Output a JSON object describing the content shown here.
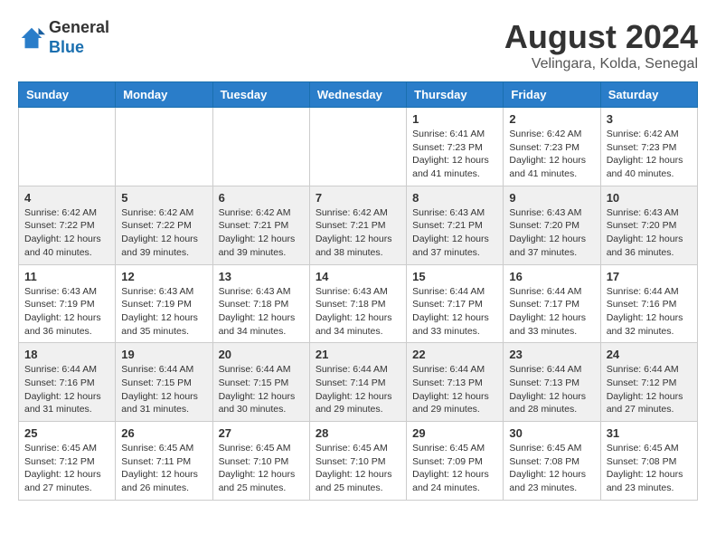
{
  "header": {
    "logo_line1": "General",
    "logo_line2": "Blue",
    "title": "August 2024",
    "subtitle": "Velingara, Kolda, Senegal"
  },
  "weekdays": [
    "Sunday",
    "Monday",
    "Tuesday",
    "Wednesday",
    "Thursday",
    "Friday",
    "Saturday"
  ],
  "weeks": [
    [
      {
        "day": "",
        "info": ""
      },
      {
        "day": "",
        "info": ""
      },
      {
        "day": "",
        "info": ""
      },
      {
        "day": "",
        "info": ""
      },
      {
        "day": "1",
        "info": "Sunrise: 6:41 AM\nSunset: 7:23 PM\nDaylight: 12 hours\nand 41 minutes."
      },
      {
        "day": "2",
        "info": "Sunrise: 6:42 AM\nSunset: 7:23 PM\nDaylight: 12 hours\nand 41 minutes."
      },
      {
        "day": "3",
        "info": "Sunrise: 6:42 AM\nSunset: 7:23 PM\nDaylight: 12 hours\nand 40 minutes."
      }
    ],
    [
      {
        "day": "4",
        "info": "Sunrise: 6:42 AM\nSunset: 7:22 PM\nDaylight: 12 hours\nand 40 minutes."
      },
      {
        "day": "5",
        "info": "Sunrise: 6:42 AM\nSunset: 7:22 PM\nDaylight: 12 hours\nand 39 minutes."
      },
      {
        "day": "6",
        "info": "Sunrise: 6:42 AM\nSunset: 7:21 PM\nDaylight: 12 hours\nand 39 minutes."
      },
      {
        "day": "7",
        "info": "Sunrise: 6:42 AM\nSunset: 7:21 PM\nDaylight: 12 hours\nand 38 minutes."
      },
      {
        "day": "8",
        "info": "Sunrise: 6:43 AM\nSunset: 7:21 PM\nDaylight: 12 hours\nand 37 minutes."
      },
      {
        "day": "9",
        "info": "Sunrise: 6:43 AM\nSunset: 7:20 PM\nDaylight: 12 hours\nand 37 minutes."
      },
      {
        "day": "10",
        "info": "Sunrise: 6:43 AM\nSunset: 7:20 PM\nDaylight: 12 hours\nand 36 minutes."
      }
    ],
    [
      {
        "day": "11",
        "info": "Sunrise: 6:43 AM\nSunset: 7:19 PM\nDaylight: 12 hours\nand 36 minutes."
      },
      {
        "day": "12",
        "info": "Sunrise: 6:43 AM\nSunset: 7:19 PM\nDaylight: 12 hours\nand 35 minutes."
      },
      {
        "day": "13",
        "info": "Sunrise: 6:43 AM\nSunset: 7:18 PM\nDaylight: 12 hours\nand 34 minutes."
      },
      {
        "day": "14",
        "info": "Sunrise: 6:43 AM\nSunset: 7:18 PM\nDaylight: 12 hours\nand 34 minutes."
      },
      {
        "day": "15",
        "info": "Sunrise: 6:44 AM\nSunset: 7:17 PM\nDaylight: 12 hours\nand 33 minutes."
      },
      {
        "day": "16",
        "info": "Sunrise: 6:44 AM\nSunset: 7:17 PM\nDaylight: 12 hours\nand 33 minutes."
      },
      {
        "day": "17",
        "info": "Sunrise: 6:44 AM\nSunset: 7:16 PM\nDaylight: 12 hours\nand 32 minutes."
      }
    ],
    [
      {
        "day": "18",
        "info": "Sunrise: 6:44 AM\nSunset: 7:16 PM\nDaylight: 12 hours\nand 31 minutes."
      },
      {
        "day": "19",
        "info": "Sunrise: 6:44 AM\nSunset: 7:15 PM\nDaylight: 12 hours\nand 31 minutes."
      },
      {
        "day": "20",
        "info": "Sunrise: 6:44 AM\nSunset: 7:15 PM\nDaylight: 12 hours\nand 30 minutes."
      },
      {
        "day": "21",
        "info": "Sunrise: 6:44 AM\nSunset: 7:14 PM\nDaylight: 12 hours\nand 29 minutes."
      },
      {
        "day": "22",
        "info": "Sunrise: 6:44 AM\nSunset: 7:13 PM\nDaylight: 12 hours\nand 29 minutes."
      },
      {
        "day": "23",
        "info": "Sunrise: 6:44 AM\nSunset: 7:13 PM\nDaylight: 12 hours\nand 28 minutes."
      },
      {
        "day": "24",
        "info": "Sunrise: 6:44 AM\nSunset: 7:12 PM\nDaylight: 12 hours\nand 27 minutes."
      }
    ],
    [
      {
        "day": "25",
        "info": "Sunrise: 6:45 AM\nSunset: 7:12 PM\nDaylight: 12 hours\nand 27 minutes."
      },
      {
        "day": "26",
        "info": "Sunrise: 6:45 AM\nSunset: 7:11 PM\nDaylight: 12 hours\nand 26 minutes."
      },
      {
        "day": "27",
        "info": "Sunrise: 6:45 AM\nSunset: 7:10 PM\nDaylight: 12 hours\nand 25 minutes."
      },
      {
        "day": "28",
        "info": "Sunrise: 6:45 AM\nSunset: 7:10 PM\nDaylight: 12 hours\nand 25 minutes."
      },
      {
        "day": "29",
        "info": "Sunrise: 6:45 AM\nSunset: 7:09 PM\nDaylight: 12 hours\nand 24 minutes."
      },
      {
        "day": "30",
        "info": "Sunrise: 6:45 AM\nSunset: 7:08 PM\nDaylight: 12 hours\nand 23 minutes."
      },
      {
        "day": "31",
        "info": "Sunrise: 6:45 AM\nSunset: 7:08 PM\nDaylight: 12 hours\nand 23 minutes."
      }
    ]
  ]
}
